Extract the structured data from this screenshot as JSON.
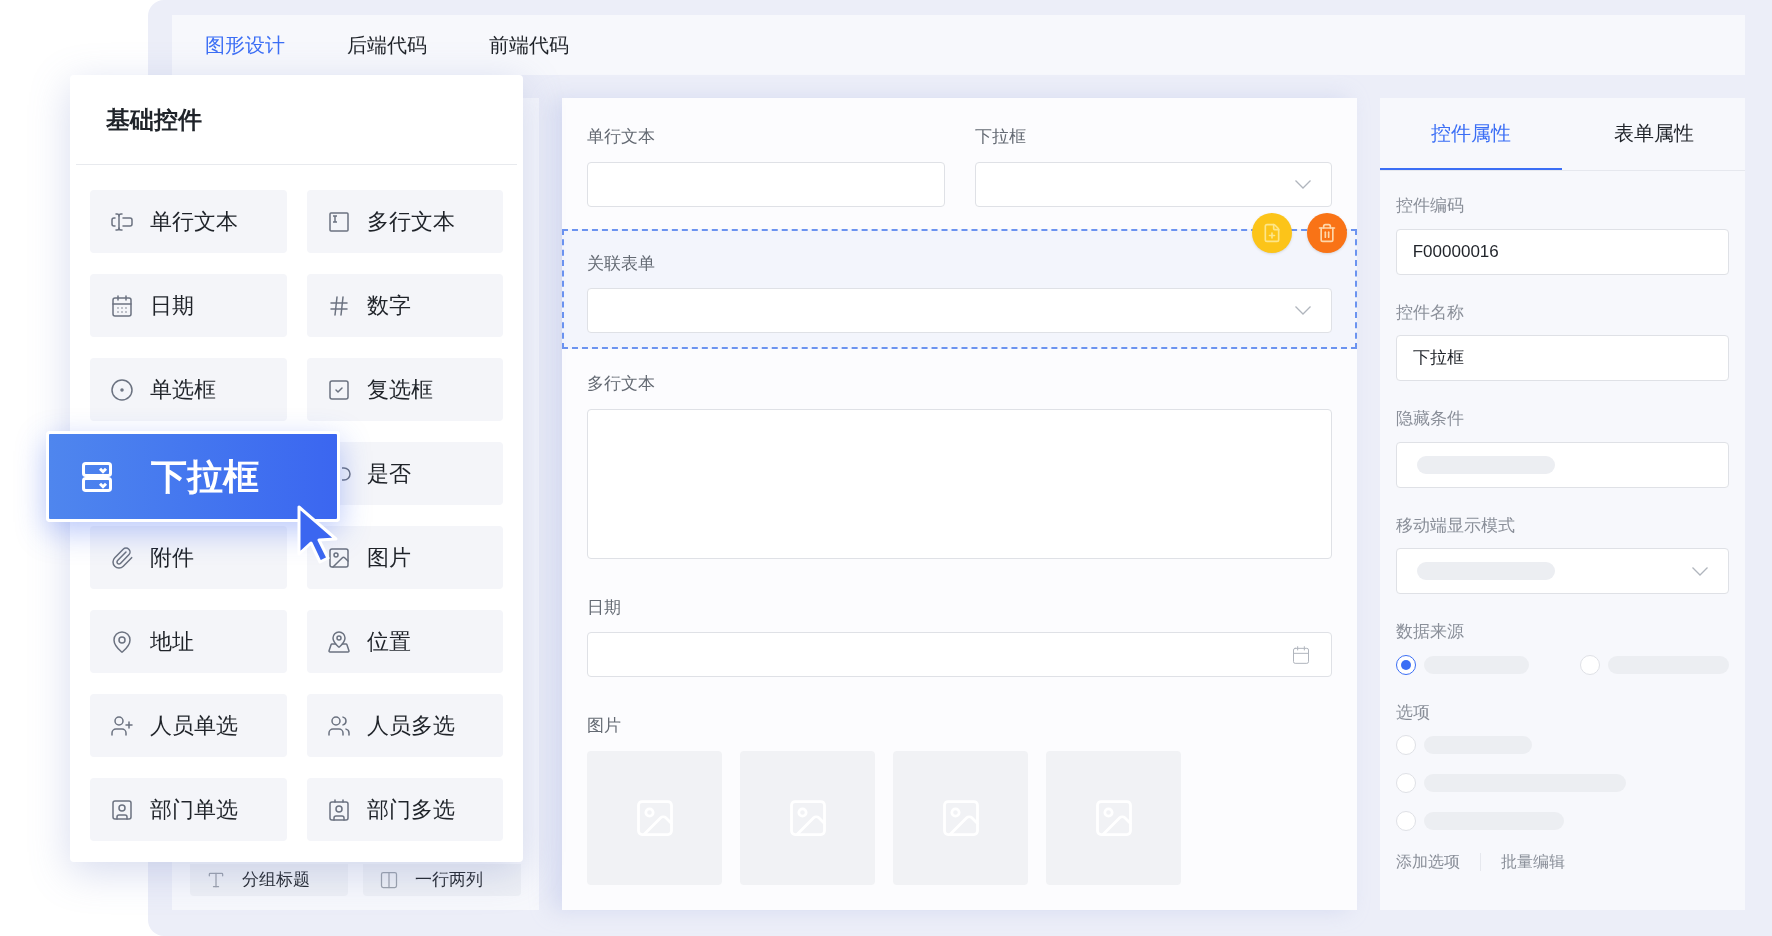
{
  "top_tabs": [
    {
      "label": "图形设计",
      "selected": true
    },
    {
      "label": "后端代码",
      "selected": false
    },
    {
      "label": "前端代码",
      "selected": false
    }
  ],
  "palette": {
    "title": "基础控件",
    "items": [
      {
        "kind": "single-line",
        "label": "单行文本"
      },
      {
        "kind": "multi-line",
        "label": "多行文本"
      },
      {
        "kind": "date",
        "label": "日期"
      },
      {
        "kind": "number",
        "label": "数字"
      },
      {
        "kind": "radio",
        "label": "单选框"
      },
      {
        "kind": "checkbox",
        "label": "复选框"
      },
      {
        "kind": "toggle",
        "label": "是否"
      },
      {
        "kind": "attachment",
        "label": "附件"
      },
      {
        "kind": "image",
        "label": "图片"
      },
      {
        "kind": "address",
        "label": "地址"
      },
      {
        "kind": "location",
        "label": "位置"
      },
      {
        "kind": "user",
        "label": "人员单选"
      },
      {
        "kind": "users",
        "label": "人员多选"
      },
      {
        "kind": "dept",
        "label": "部门单选"
      },
      {
        "kind": "depts",
        "label": "部门多选"
      }
    ]
  },
  "layout_items": [
    {
      "kind": "heading",
      "label": "分组标题"
    },
    {
      "kind": "columns",
      "label": "一行两列"
    }
  ],
  "dragged": {
    "kind": "dropdown",
    "label": "下拉框"
  },
  "canvas": {
    "rows": [
      {
        "selected": false,
        "fields": [
          {
            "kind": "text",
            "label": "单行文本"
          },
          {
            "kind": "select",
            "label": "下拉框"
          }
        ]
      },
      {
        "selected": true,
        "fields": [
          {
            "kind": "select",
            "label": "关联表单"
          }
        ]
      },
      {
        "selected": false,
        "fields": [
          {
            "kind": "textarea",
            "label": "多行文本"
          }
        ]
      },
      {
        "selected": false,
        "fields": [
          {
            "kind": "date",
            "label": "日期"
          }
        ]
      },
      {
        "selected": false,
        "fields": [
          {
            "kind": "images",
            "label": "图片"
          }
        ]
      }
    ]
  },
  "properties": {
    "tabs": [
      {
        "label": "控件属性",
        "selected": true
      },
      {
        "label": "表单属性",
        "selected": false
      }
    ],
    "fields": [
      {
        "kind": "input",
        "label": "控件编码",
        "value": "F00000016"
      },
      {
        "kind": "input",
        "label": "控件名称",
        "value": "下拉框"
      },
      {
        "kind": "input-skeleton",
        "label": "隐藏条件"
      },
      {
        "kind": "select-skeleton",
        "label": "移动端显示模式"
      },
      {
        "kind": "radio-row",
        "label": "数据来源",
        "options": [
          {
            "selected": true
          },
          {
            "selected": false
          }
        ]
      },
      {
        "kind": "radio-list",
        "label": "选项",
        "options": [
          {
            "selected": false
          },
          {
            "selected": false
          },
          {
            "selected": false
          }
        ]
      }
    ],
    "links": [
      "添加选项",
      "批量编辑"
    ]
  }
}
